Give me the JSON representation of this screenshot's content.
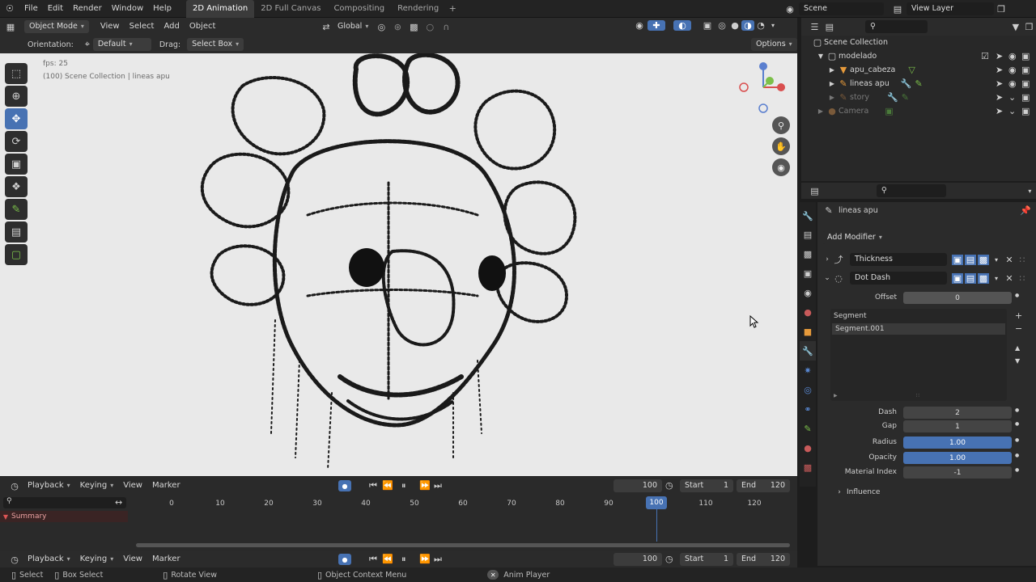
{
  "topbar": {
    "menus": [
      "File",
      "Edit",
      "Render",
      "Window",
      "Help"
    ],
    "workspaces": [
      "2D Animation",
      "2D Full Canvas",
      "Compositing",
      "Rendering"
    ],
    "active_workspace": "2D Animation",
    "scene": "Scene",
    "view_layer": "View Layer"
  },
  "viewport_header": {
    "mode": "Object Mode",
    "menus": [
      "View",
      "Select",
      "Add",
      "Object"
    ],
    "transform": "Global"
  },
  "tool_header": {
    "orientation_label": "Orientation:",
    "orientation_value": "Default",
    "drag_label": "Drag:",
    "drag_value": "Select Box",
    "options": "Options"
  },
  "viewport": {
    "fps": "fps: 25",
    "collection_path": "(100) Scene Collection | lineas apu"
  },
  "outliner": {
    "root": "Scene Collection",
    "items": [
      {
        "name": "modelado",
        "color": "#d6d6d6"
      },
      {
        "name": "apu_cabeza",
        "color": "#d6d6d6"
      },
      {
        "name": "lineas apu",
        "color": "#d6d6d6"
      },
      {
        "name": "story",
        "color": "#7a7a7a"
      },
      {
        "name": "Camera",
        "color": "#7a7a7a"
      }
    ]
  },
  "properties": {
    "object_name": "lineas apu",
    "add_modifier": "Add Modifier",
    "modifiers": [
      {
        "name": "Thickness"
      },
      {
        "name": "Dot Dash"
      }
    ],
    "offset_label": "Offset",
    "offset_value": "0",
    "segment_header": "Segment",
    "segment_item": "Segment.001",
    "dash_label": "Dash",
    "dash_value": "2",
    "gap_label": "Gap",
    "gap_value": "1",
    "radius_label": "Radius",
    "radius_value": "1.00",
    "opacity_label": "Opacity",
    "opacity_value": "1.00",
    "material_label": "Material Index",
    "material_value": "-1",
    "influence": "Influence"
  },
  "timeline": {
    "menus": [
      "Playback",
      "Keying",
      "View",
      "Marker"
    ],
    "current_frame": "100",
    "start_label": "Start",
    "start_value": "1",
    "end_label": "End",
    "end_value": "120",
    "ticks": [
      "0",
      "10",
      "20",
      "30",
      "40",
      "50",
      "60",
      "70",
      "80",
      "90",
      "100",
      "110",
      "120"
    ],
    "summary": "Summary"
  },
  "status": {
    "select": "Select",
    "box_select": "Box Select",
    "rotate_view": "Rotate View",
    "context_menu": "Object Context Menu",
    "anim_player": "Anim Player"
  }
}
